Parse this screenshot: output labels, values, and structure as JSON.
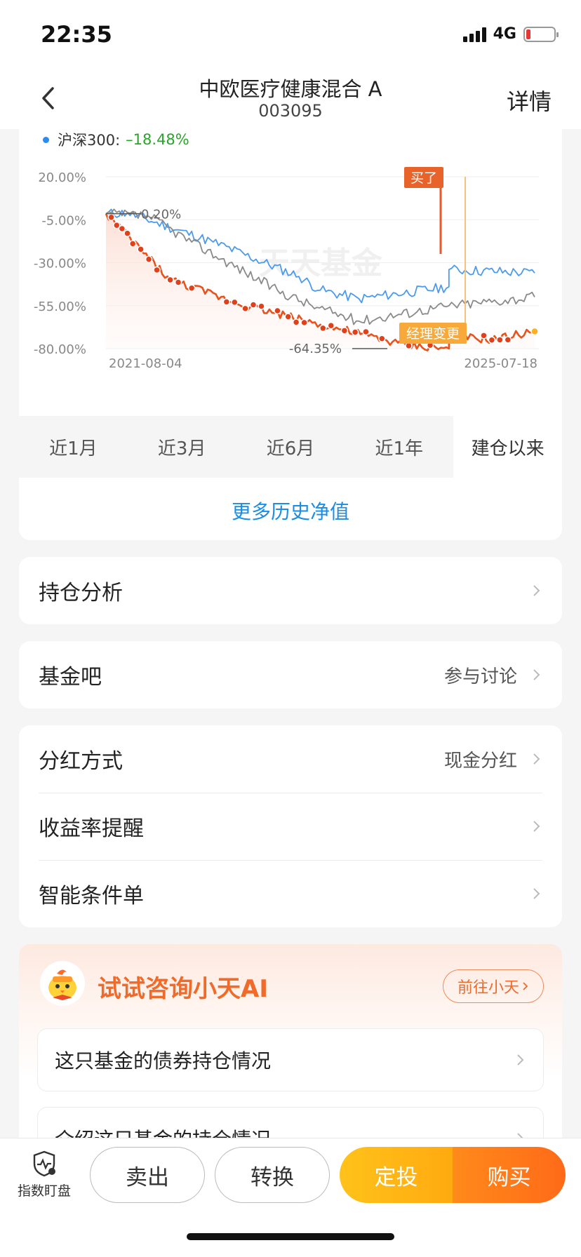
{
  "status": {
    "time": "22:35",
    "network": "4G"
  },
  "nav": {
    "title": "中欧医疗健康混合 A",
    "code": "003095",
    "detail": "详情"
  },
  "legend": {
    "name": "沪深300:",
    "value": "–18.48%",
    "dot_color": "#2b8cf0"
  },
  "chart_data": {
    "type": "line",
    "y_ticks": [
      "20.00%",
      "-5.00%",
      "-30.00%",
      "-55.00%",
      "-80.00%"
    ],
    "ylim": [
      -80,
      20
    ],
    "x_labels": [
      "2021-08-04",
      "2025-07-18"
    ],
    "watermark": "天天基金",
    "annotations": {
      "top": "0.20%",
      "bottom": "-64.35%"
    },
    "markers": {
      "bought": "买了",
      "manager_change": "经理变更"
    },
    "series": [
      {
        "name": "沪深300",
        "color": "#4a9af0",
        "key_points": [
          [
            0,
            -1.5
          ],
          [
            0.05,
            -1
          ],
          [
            0.25,
            -18
          ],
          [
            0.45,
            -38
          ],
          [
            0.5,
            -46
          ],
          [
            0.59,
            -51
          ],
          [
            0.8,
            -44
          ],
          [
            0.8,
            -34
          ],
          [
            1,
            -36
          ]
        ]
      },
      {
        "color": "#8a8a8a",
        "key_points": [
          [
            0,
            -1.5
          ],
          [
            0.1,
            -3
          ],
          [
            0.2,
            -18
          ],
          [
            0.4,
            -46
          ],
          [
            0.48,
            -55
          ],
          [
            0.59,
            -64
          ],
          [
            0.8,
            -55
          ],
          [
            1,
            -50
          ]
        ]
      },
      {
        "color": "#e8521c",
        "key_points": [
          [
            0,
            -1.5
          ],
          [
            0.15,
            -40
          ],
          [
            0.3,
            -53
          ],
          [
            0.5,
            -66
          ],
          [
            0.7,
            -78
          ],
          [
            0.8,
            -80
          ],
          [
            0.8,
            -73
          ],
          [
            0.9,
            -75
          ],
          [
            1,
            -70
          ]
        ]
      }
    ]
  },
  "range_tabs": [
    {
      "label": "近1月",
      "active": false
    },
    {
      "label": "近3月",
      "active": false
    },
    {
      "label": "近6月",
      "active": false
    },
    {
      "label": "近1年",
      "active": false
    },
    {
      "label": "建仓以来",
      "active": true
    }
  ],
  "more_history": "更多历史净值",
  "holdings": {
    "label": "持仓分析"
  },
  "forum": {
    "label": "基金吧",
    "value": "参与讨论"
  },
  "settings": [
    {
      "label": "分红方式",
      "value": "现金分红"
    },
    {
      "label": "收益率提醒",
      "value": ""
    },
    {
      "label": "智能条件单",
      "value": ""
    }
  ],
  "ai": {
    "title": "试试咨询小天AI",
    "goto": "前往小天",
    "questions": [
      "这只基金的债券持仓情况",
      "介绍这只基金的持仓情况"
    ]
  },
  "bottom": {
    "monitor": "指数盯盘",
    "sell": "卖出",
    "convert": "转换",
    "dingtou": "定投",
    "buy": "购买"
  }
}
